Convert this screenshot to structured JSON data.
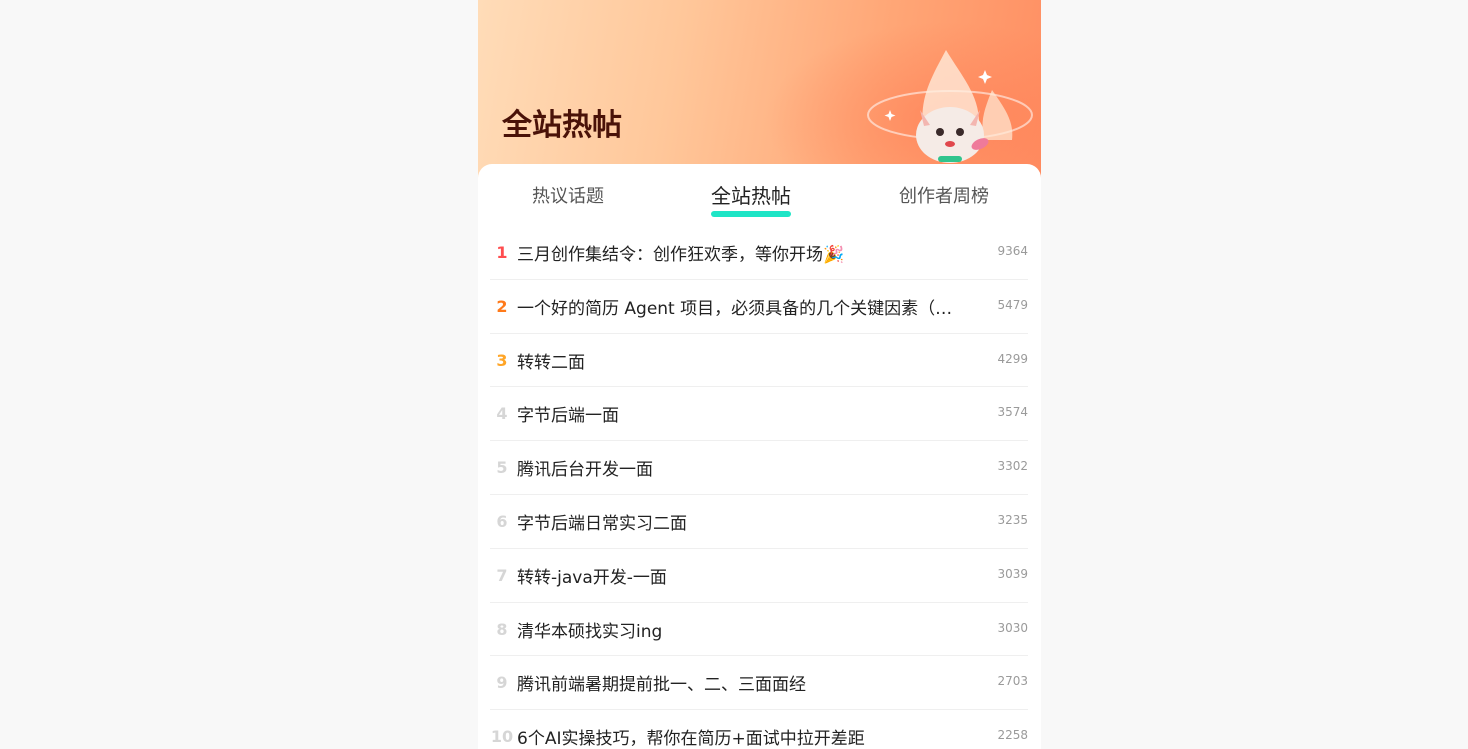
{
  "banner": {
    "title": "全站热帖"
  },
  "tabs": [
    {
      "label": "热议话题",
      "active": false
    },
    {
      "label": "全站热帖",
      "active": true
    },
    {
      "label": "创作者周榜",
      "active": false
    }
  ],
  "colors": {
    "accent": "#1ee5c6",
    "rank1": "#ff4d4f",
    "rank2": "#ff7a1a",
    "rank3": "#ffa527"
  },
  "posts": [
    {
      "rank": "1",
      "title": "三月创作集结令：创作狂欢季，等你开场🎉",
      "count": "9364"
    },
    {
      "rank": "2",
      "title": "一个好的简历 Agent 项目，必须具备的几个关键因素（附…",
      "count": "5479"
    },
    {
      "rank": "3",
      "title": "转转二面",
      "count": "4299"
    },
    {
      "rank": "4",
      "title": "字节后端一面",
      "count": "3574"
    },
    {
      "rank": "5",
      "title": "腾讯后台开发一面",
      "count": "3302"
    },
    {
      "rank": "6",
      "title": "字节后端日常实习二面",
      "count": "3235"
    },
    {
      "rank": "7",
      "title": "转转-java开发-一面",
      "count": "3039"
    },
    {
      "rank": "8",
      "title": "清华本硕找实习ing",
      "count": "3030"
    },
    {
      "rank": "9",
      "title": "腾讯前端暑期提前批一、二、三面面经",
      "count": "2703"
    },
    {
      "rank": "10",
      "title": "6个AI实操技巧，帮你在简历+面试中拉开差距",
      "count": "2258"
    }
  ]
}
